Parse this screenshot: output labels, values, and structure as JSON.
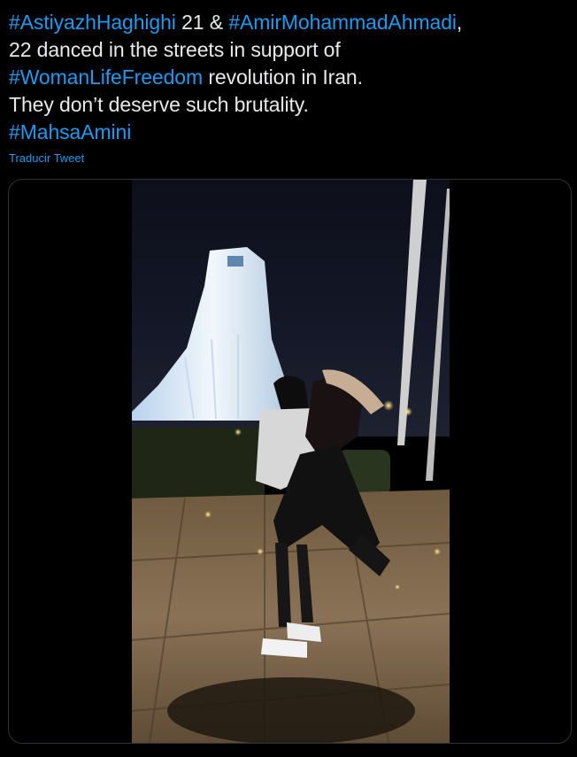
{
  "tweet": {
    "line1": {
      "tag1": "#AstiyazhHaghighi",
      "text1": " 21 & ",
      "tag2": "#AmirMohammadAhmadi",
      "text2": ","
    },
    "line2": {
      "text": "22 danced in the streets in support of"
    },
    "line3": {
      "tag": "#WomanLifeFreedom",
      "text": " revolution in Iran."
    },
    "line4": {
      "text": "They don’t deserve such brutality."
    },
    "line5": {
      "tag": "#MahsaAmini"
    },
    "translate_label": "Traducir Tweet"
  },
  "media": {
    "type": "video",
    "scene": "couple-dancing-azadi-tower-night"
  },
  "colors": {
    "background": "#000000",
    "text": "#e7e9ea",
    "link": "#1d9bf0",
    "border": "#2f3336"
  }
}
